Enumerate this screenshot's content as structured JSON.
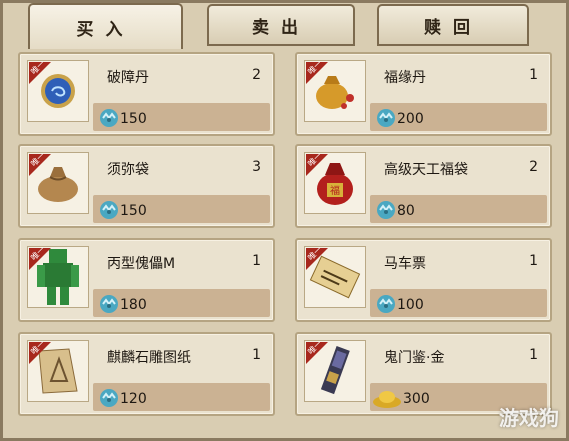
{
  "tabs": [
    {
      "label": "买入",
      "active": true
    },
    {
      "label": "卖出",
      "active": false
    },
    {
      "label": "赎回",
      "active": false
    }
  ],
  "badge_text": "唯一",
  "items": [
    {
      "name": "破障丹",
      "qty": "2",
      "price": "150",
      "currency_icon": "jade-coin-icon",
      "icon": "blue-orb-icon"
    },
    {
      "name": "福缘丹",
      "qty": "1",
      "price": "200",
      "currency_icon": "jade-coin-icon",
      "icon": "gold-pouch-icon"
    },
    {
      "name": "须弥袋",
      "qty": "3",
      "price": "150",
      "currency_icon": "jade-coin-icon",
      "icon": "cloth-bag-icon"
    },
    {
      "name": "高级天工福袋",
      "qty": "2",
      "price": "80",
      "currency_icon": "jade-coin-icon",
      "icon": "red-lucky-bag-icon"
    },
    {
      "name": "丙型傀儡M",
      "qty": "1",
      "price": "180",
      "currency_icon": "jade-coin-icon",
      "icon": "green-puppet-icon"
    },
    {
      "name": "马车票",
      "qty": "1",
      "price": "100",
      "currency_icon": "jade-coin-icon",
      "icon": "ticket-scroll-icon"
    },
    {
      "name": "麒麟石雕图纸",
      "qty": "1",
      "price": "120",
      "currency_icon": "jade-coin-icon",
      "icon": "blueprint-icon"
    },
    {
      "name": "鬼门鉴·金",
      "qty": "1",
      "price": "300",
      "currency_icon": "gold-ingot-icon",
      "icon": "mirror-artifact-icon"
    }
  ],
  "watermark": "游戏狗",
  "colors": {
    "badge": "#a8281d",
    "coin": "#4aa8c2",
    "ingot": "#d9a926"
  }
}
